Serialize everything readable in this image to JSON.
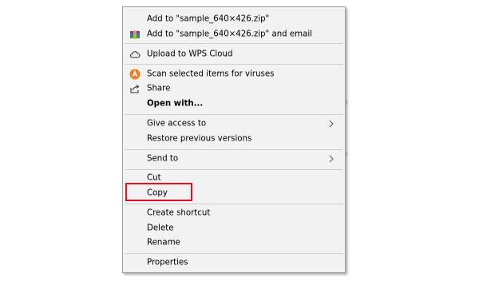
{
  "context_menu": {
    "items": [
      {
        "label": "Add to \"sample_640×426.zip\"",
        "icon": "none"
      },
      {
        "label": "Add to \"sample_640×426.zip\" and email",
        "icon": "winrar-icon"
      },
      {
        "label": "Upload to WPS Cloud",
        "icon": "cloud-icon"
      },
      {
        "label": "Scan selected items for viruses",
        "icon": "avast-icon"
      },
      {
        "label": "Share",
        "icon": "share-icon"
      },
      {
        "label": "Open with...",
        "icon": "none"
      },
      {
        "label": "Give access to",
        "icon": "none"
      },
      {
        "label": "Restore previous versions",
        "icon": "none"
      },
      {
        "label": "Send to",
        "icon": "none"
      },
      {
        "label": "Cut",
        "icon": "none"
      },
      {
        "label": "Copy",
        "icon": "none"
      },
      {
        "label": "Create shortcut",
        "icon": "none"
      },
      {
        "label": "Delete",
        "icon": "none"
      },
      {
        "label": "Rename",
        "icon": "none"
      },
      {
        "label": "Properties",
        "icon": "none"
      }
    ],
    "highlighted_item": "Copy"
  },
  "colors": {
    "menu_background": "#f2f2f2",
    "highlight_border": "#e1121f",
    "avast_orange": "#f47c20",
    "winrar_purple": "#7a3fa0"
  }
}
